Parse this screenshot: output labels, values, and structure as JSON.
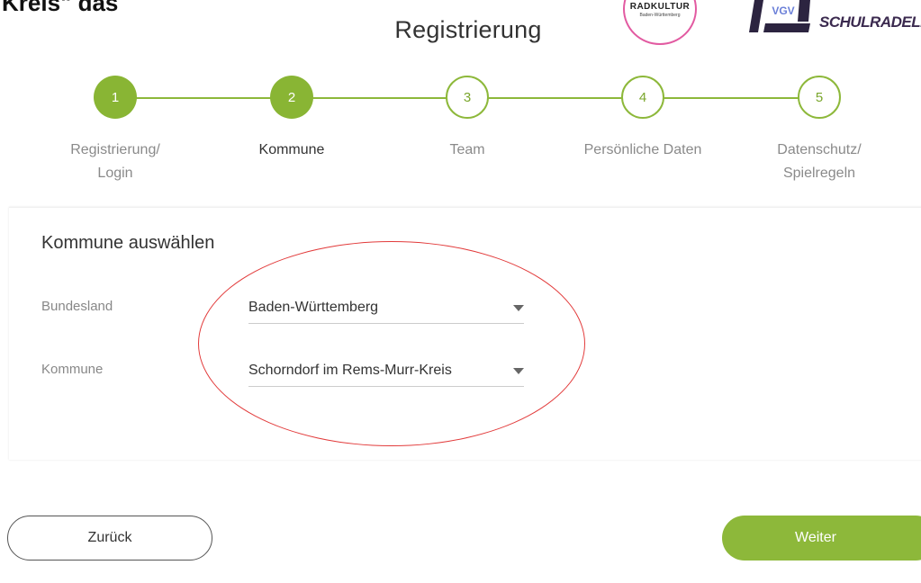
{
  "corner_text": "Kreis\" das",
  "header": {
    "title": "Registrierung",
    "logos": {
      "radkultur": {
        "name": "RADKULTUR",
        "subtitle": "Baden-Württemberg"
      },
      "schulradeln": {
        "mark": "VGV",
        "name": "SCHULRADELN"
      }
    }
  },
  "stepper": {
    "steps": [
      {
        "number": "1",
        "label_line1": "Registrierung/",
        "label_line2": "Login",
        "state": "done"
      },
      {
        "number": "2",
        "label_line1": "Kommune",
        "label_line2": "",
        "state": "current"
      },
      {
        "number": "3",
        "label_line1": "Team",
        "label_line2": "",
        "state": "todo"
      },
      {
        "number": "4",
        "label_line1": "Persönliche Daten",
        "label_line2": "",
        "state": "todo"
      },
      {
        "number": "5",
        "label_line1": "Datenschutz/",
        "label_line2": "Spielregeln",
        "state": "todo"
      }
    ]
  },
  "form": {
    "title": "Kommune auswählen",
    "bundesland": {
      "label": "Bundesland",
      "value": "Baden-Württemberg"
    },
    "kommune": {
      "label": "Kommune",
      "value": "Schorndorf im Rems-Murr-Kreis"
    }
  },
  "buttons": {
    "back": "Zurück",
    "next": "Weiter"
  },
  "colors": {
    "accent": "#8db83a",
    "annotation": "#e23b3b",
    "logo_ring": "#e25aa1"
  }
}
